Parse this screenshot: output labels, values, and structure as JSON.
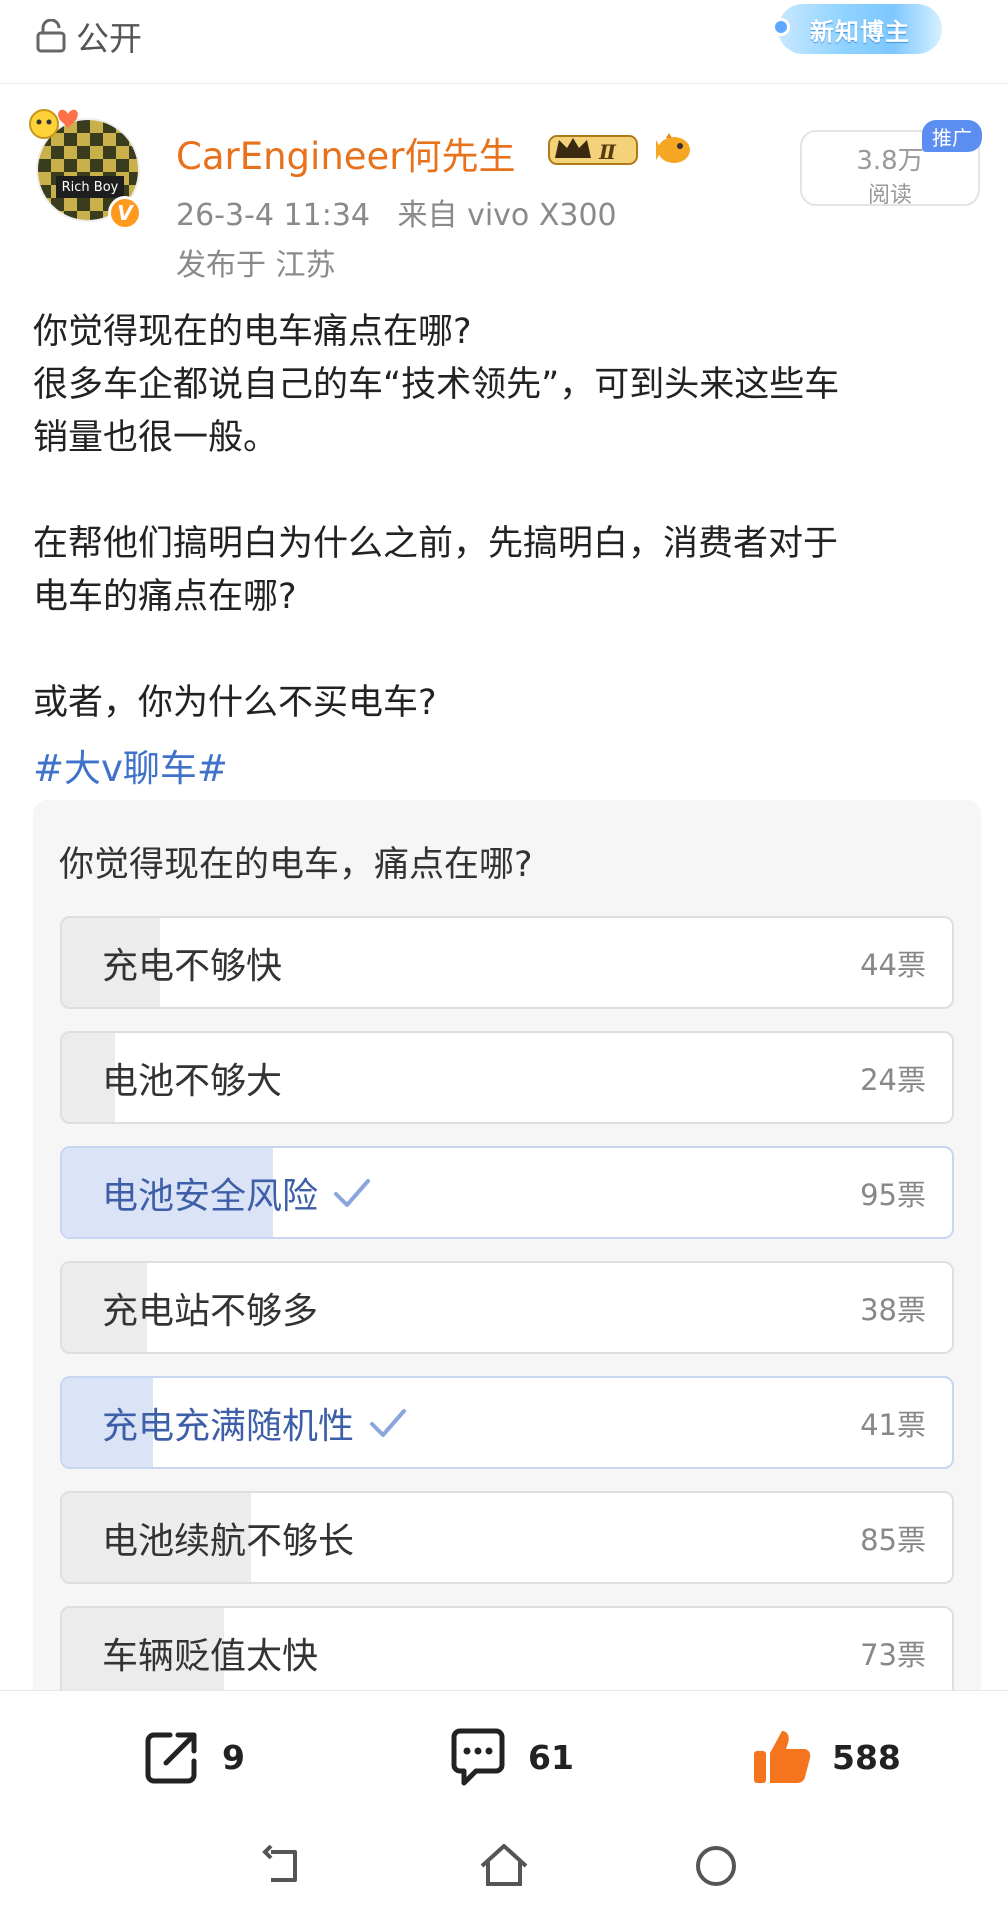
{
  "topbar": {
    "visibility_label": "公开",
    "badge_label": "新知博主"
  },
  "author": {
    "avatar_text": "Rich Boy",
    "verified_mark": "V",
    "name": "CarEngineer何先生",
    "level_badge": "Ⅱ",
    "date": "26-3-4 11:34",
    "source": "来自 vivo X300",
    "location": "发布于 江苏"
  },
  "stats": {
    "reads": "3.8万",
    "reads_label": "阅读",
    "promo_label": "推广"
  },
  "post": {
    "lines": [
      "你觉得现在的电车痛点在哪?",
      "很多车企都说自己的车“技术领先”，可到头来这些车",
      "销量也很一般。",
      "",
      "在帮他们搞明白为什么之前，先搞明白，消费者对于",
      "电车的痛点在哪?",
      "",
      "或者，你为什么不买电车?"
    ],
    "hashtag": "#大v聊车#"
  },
  "poll": {
    "question": "你觉得现在的电车，痛点在哪?",
    "options": [
      {
        "label": "充电不够快",
        "votes": "44票",
        "count": 44,
        "selected": false
      },
      {
        "label": "电池不够大",
        "votes": "24票",
        "count": 24,
        "selected": false
      },
      {
        "label": "电池安全风险",
        "votes": "95票",
        "count": 95,
        "selected": true
      },
      {
        "label": "充电站不够多",
        "votes": "38票",
        "count": 38,
        "selected": false
      },
      {
        "label": "充电充满随机性",
        "votes": "41票",
        "count": 41,
        "selected": true
      },
      {
        "label": "电池续航不够长",
        "votes": "85票",
        "count": 85,
        "selected": false
      },
      {
        "label": "车辆贬值太快",
        "votes": "73票",
        "count": 73,
        "selected": false
      }
    ]
  },
  "actions": {
    "reposts": "9",
    "comments": "61",
    "likes": "588"
  },
  "colors": {
    "accent_name": "#e8721c",
    "link": "#3f72c8",
    "selected_fill": "#dbe3f7",
    "like": "#f4751e"
  },
  "icons": [
    "lock-icon",
    "crown-badge-icon",
    "fish-icon",
    "check-icon",
    "share-icon",
    "comment-icon",
    "like-icon",
    "back-icon",
    "home-icon",
    "recent-icon"
  ]
}
